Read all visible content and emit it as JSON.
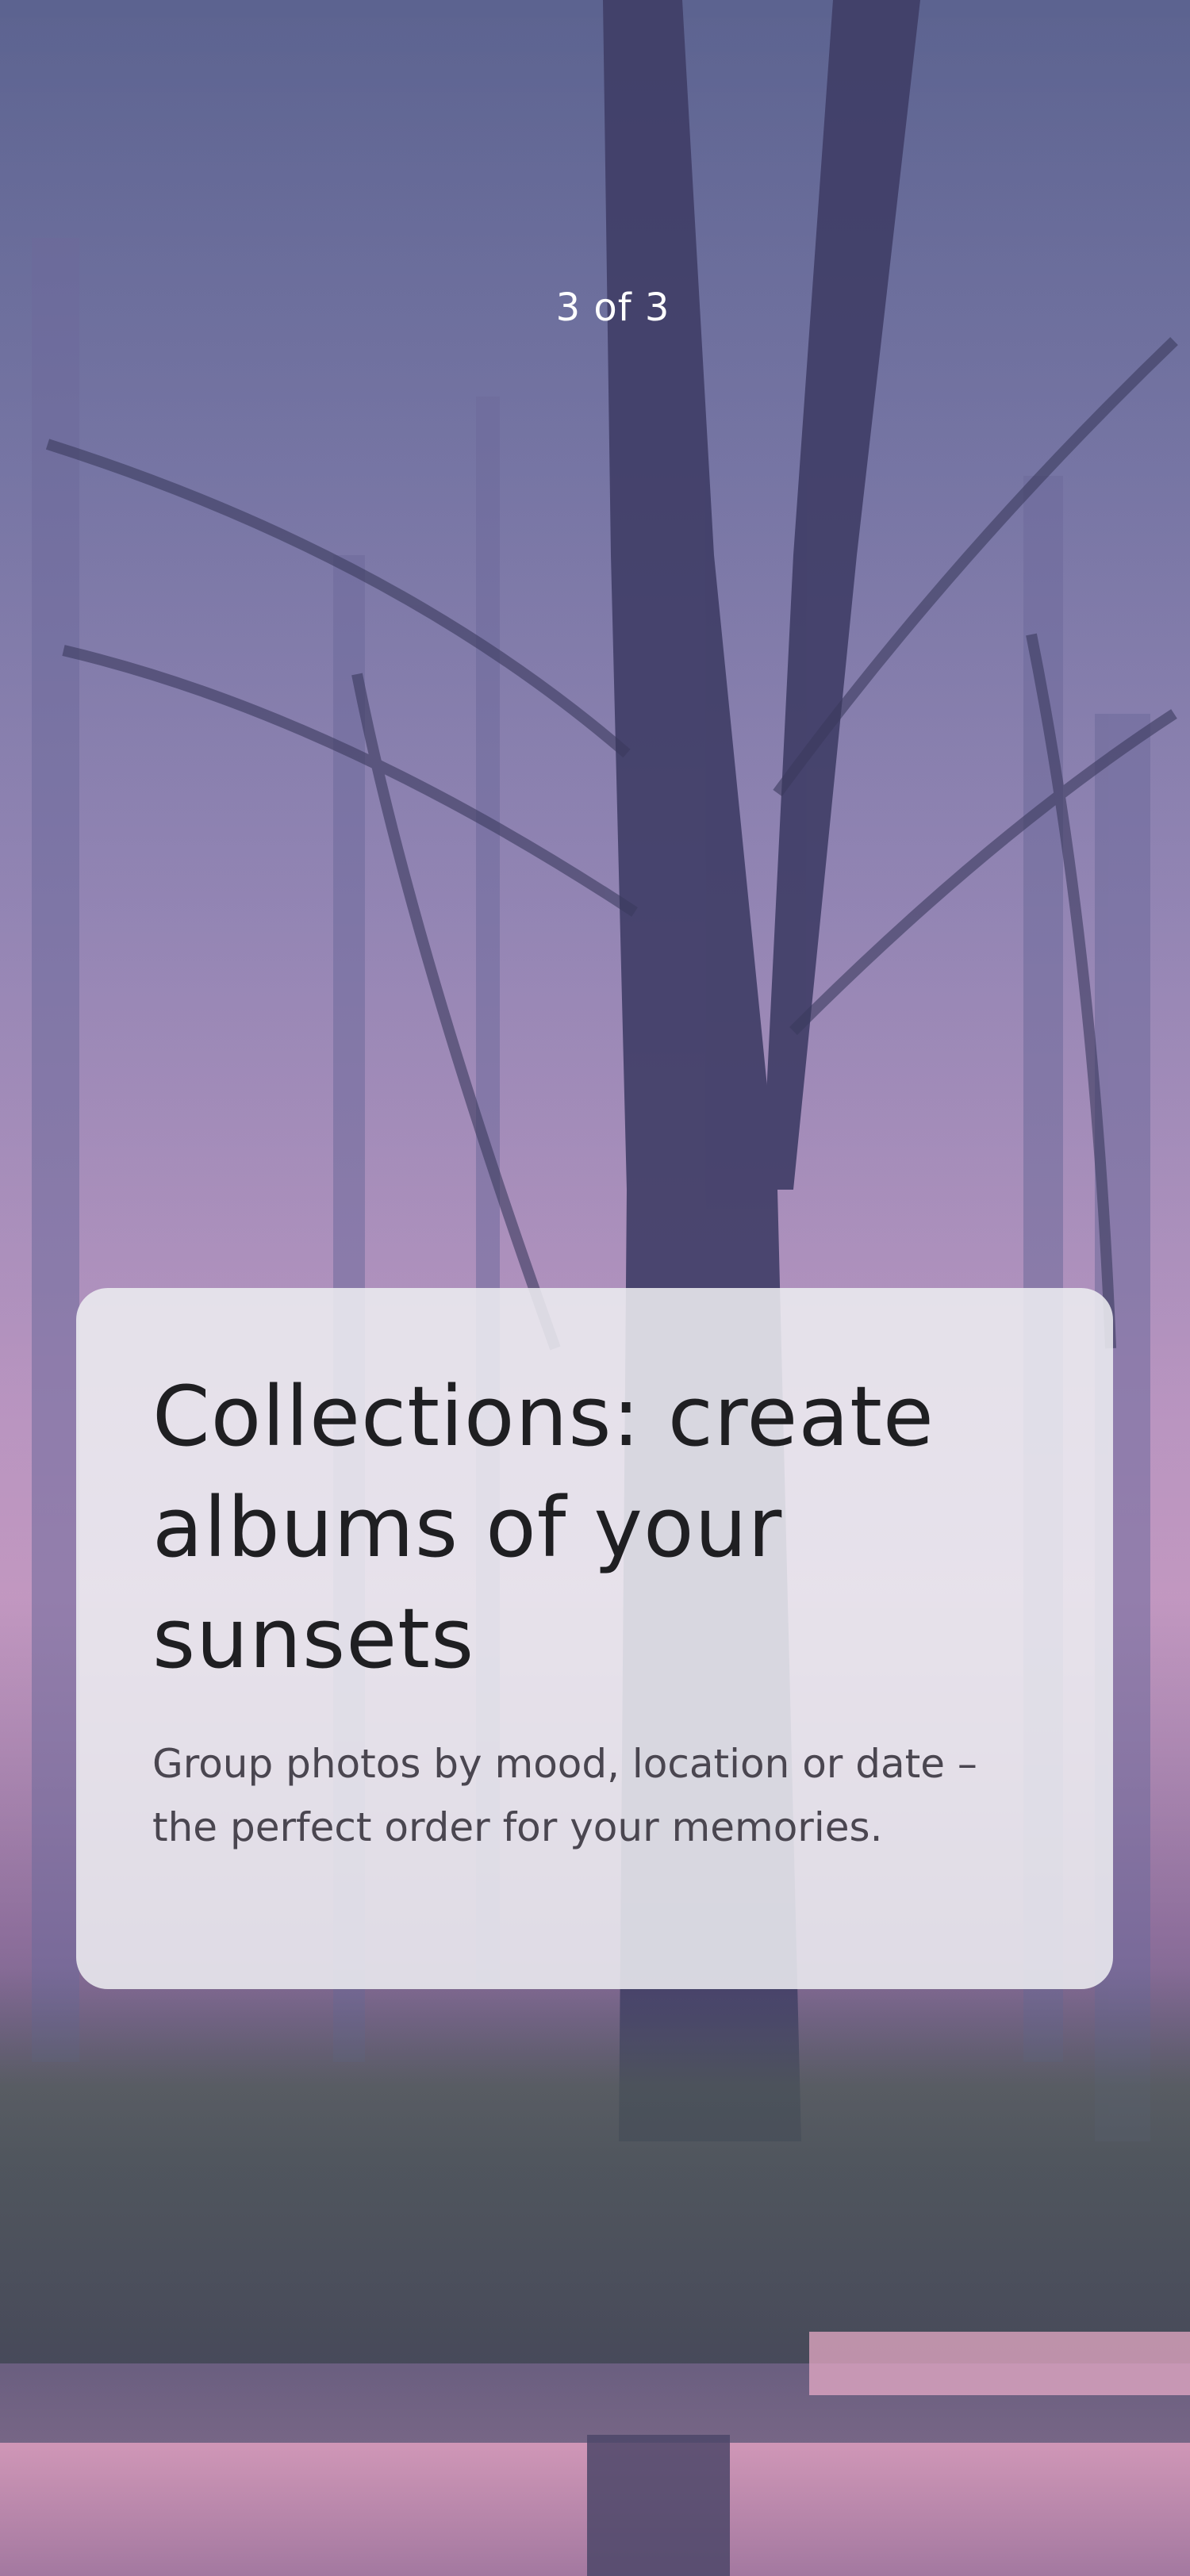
{
  "onboarding": {
    "page_indicator": "3 of 3",
    "card": {
      "title": "Collections: create albums of your sunsets",
      "body": "Group photos by mood, location or date – the perfect order for your memories."
    }
  },
  "colors": {
    "card_background": "#ECECF0",
    "title_text": "#1F1F22",
    "body_text": "#4A4650",
    "indicator_text": "#FFFFFF"
  }
}
